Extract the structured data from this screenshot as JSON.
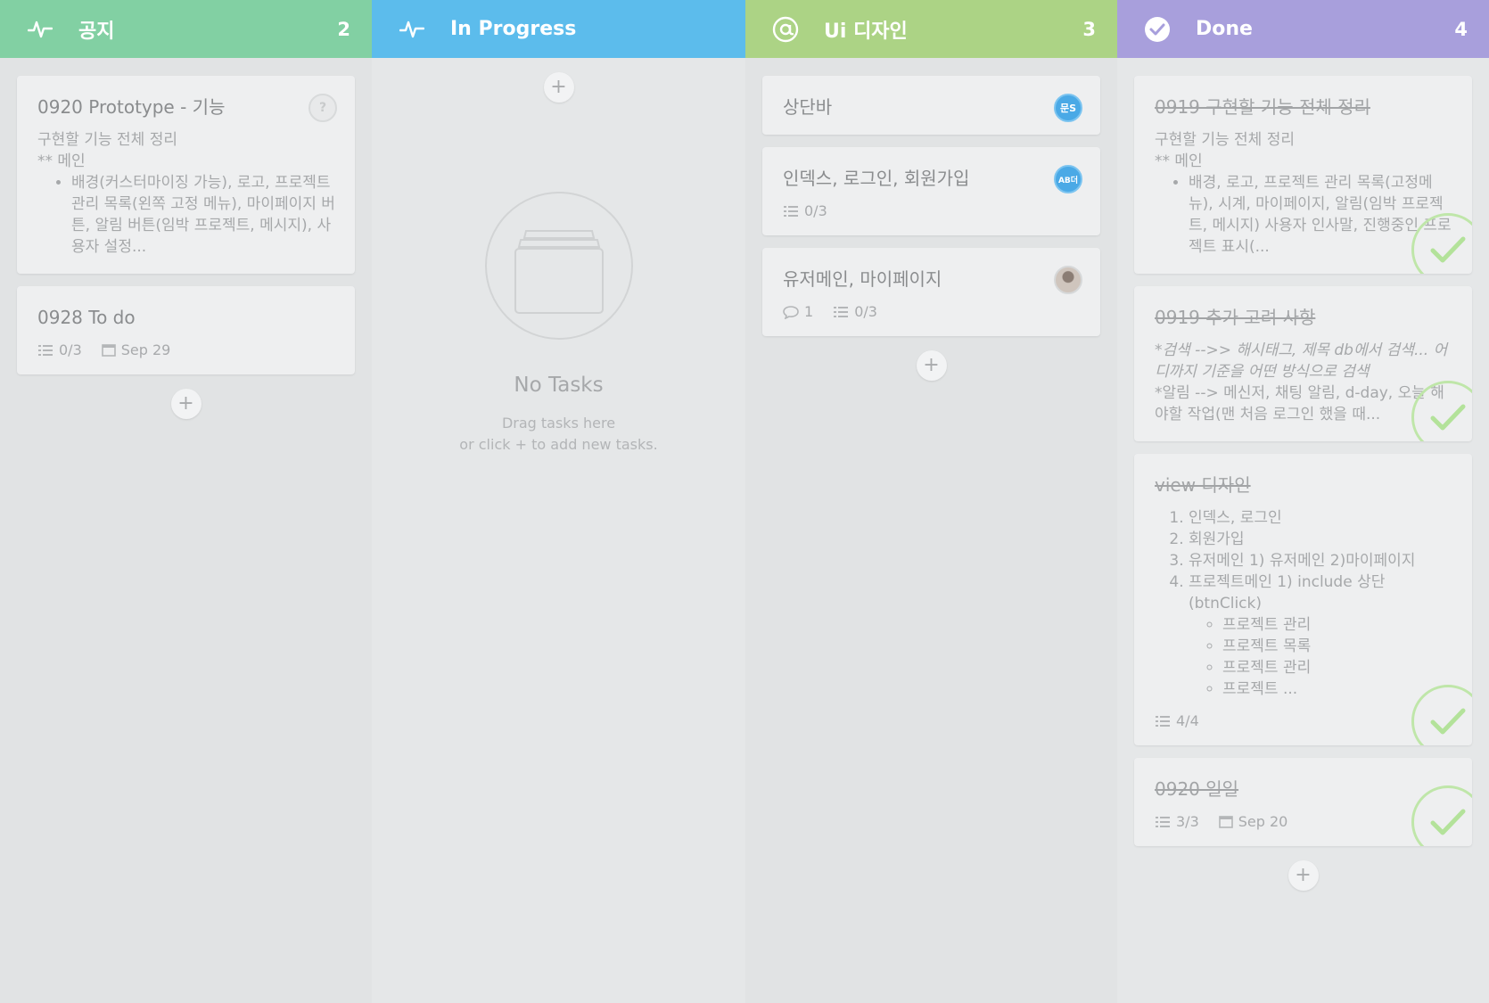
{
  "columns": [
    {
      "title": "공지",
      "count": "2",
      "icon": "activity-icon",
      "color": "#82d0a3",
      "cards": [
        {
          "title": "0920 Prototype - 기능",
          "desc_line1": "구현할 기능 전체 정리",
          "desc_line2": "** 메인",
          "bullet": "배경(커스터마이징 가능), 로고, 프로젝트 관리 목록(왼쪽 고정 메뉴), 마이페이지 버튼, 알림 버튼(임박 프로젝트, 메시지), 사용자 설정...",
          "avatar": "?"
        },
        {
          "title": "0928 To do",
          "checklist": "0/3",
          "due": "Sep 29"
        }
      ]
    },
    {
      "title": "In Progress",
      "count": "",
      "icon": "activity-icon",
      "color": "#5cbcec",
      "empty_title": "No Tasks",
      "empty_line1": "Drag tasks here",
      "empty_line2": "or click + to add new tasks."
    },
    {
      "title": "Ui 디자인",
      "count": "3",
      "icon": "at-sign-icon",
      "color": "#acd385",
      "cards": [
        {
          "title": "상단바",
          "avatar": "문S"
        },
        {
          "title": "인덱스, 로그인, 회원가입",
          "avatar": "AB더",
          "checklist": "0/3"
        },
        {
          "title": "유저메인, 마이페이지",
          "comments": "1",
          "checklist": "0/3"
        }
      ]
    },
    {
      "title": "Done",
      "count": "4",
      "icon": "check-circle-icon",
      "color": "#a89fdc",
      "cards": [
        {
          "title": "0919 구현할 기능 전체 정리",
          "desc_line1": "구현할 기능 전체 정리",
          "desc_line2": "** 메인",
          "bullet": "배경, 로고, 프로젝트 관리 목록(고정메뉴), 시계, 마이페이지, 알림(임박 프로젝트, 메시지) 사용자 인사말, 진행중인 프로젝트 표시(..."
        },
        {
          "title": "0919 추가 고려 사항",
          "line1": "*검색 -->> 해시태그, 제목 db에서 검색... 어디까지 기준을 어떤 방식으로 검색",
          "line2": "*알림 --> 메신저, 채팅 알림, d-day, 오늘 해야할 작업(맨 처음 로그인 했을 때..."
        },
        {
          "title": "view 디자인",
          "items": [
            "인덱스, 로그인",
            "회원가입",
            "유저메인 1) 유저메인 2)마이페이지",
            "프로젝트메인 1) include 상단(btnClick)"
          ],
          "subitems": [
            "프로젝트 관리",
            "프로젝트 목록",
            "프로젝트 관리",
            "프로젝트 ..."
          ],
          "checklist": "4/4"
        },
        {
          "title": "0920 일일",
          "checklist": "3/3",
          "due": "Sep 20"
        }
      ]
    }
  ]
}
